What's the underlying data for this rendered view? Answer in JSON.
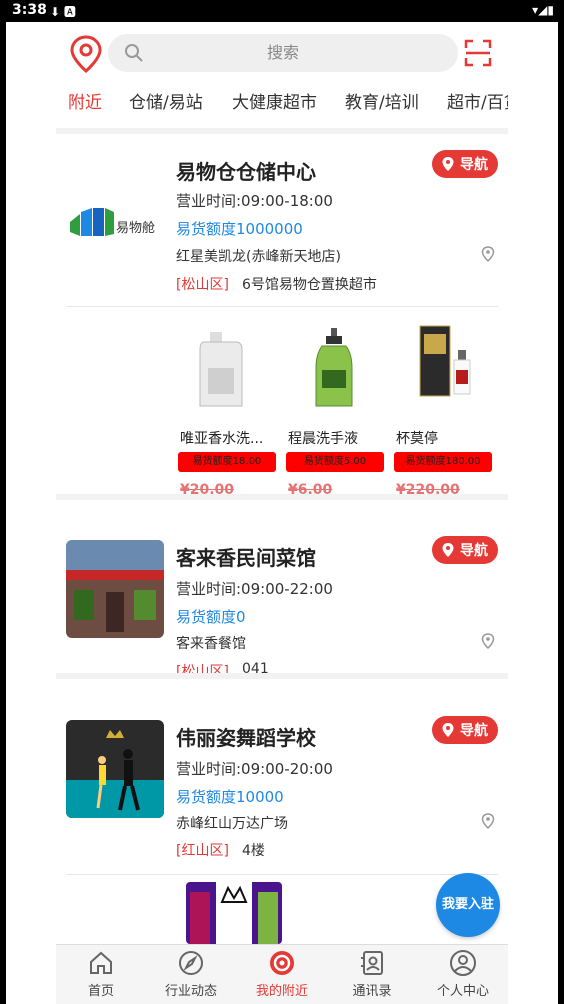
{
  "status_bar": {
    "time": "3:38",
    "left_icons": "⬇ 🅰",
    "right_icons": "▾◢▮"
  },
  "header": {
    "search_placeholder": "搜索"
  },
  "tabs": [
    "附近",
    "仓储/易站",
    "大健康超市",
    "教育/培训",
    "超市/百货"
  ],
  "colors": {
    "accent": "#e53935",
    "blue": "#1e88e5",
    "tag_red": "#ff0000"
  },
  "stores": [
    {
      "name": "易物仓仓储中心",
      "hours": "营业时间:09:00-18:00",
      "quota": "易货额度1000000",
      "address": "红星美凯龙(赤峰新天地店)",
      "district": "[松山区]",
      "address_detail": "6号馆易物仓置换超市",
      "nav_label": "导航",
      "logo_text": "易物舱",
      "products": [
        {
          "name": "唯亚香水洗...",
          "tag": "易货额度18.00",
          "price": "¥20.00"
        },
        {
          "name": "程晨洗手液",
          "tag": "易货额度5.00",
          "price": "¥6.00"
        },
        {
          "name": "杯莫停",
          "tag": "易货额度180.00",
          "price": "¥220.00"
        }
      ]
    },
    {
      "name": "客来香民间菜馆",
      "hours": "营业时间:09:00-22:00",
      "quota": "易货额度0",
      "address": "客来香餐馆",
      "district": "[松山区]",
      "address_detail": "041",
      "nav_label": "导航"
    },
    {
      "name": "伟丽姿舞蹈学校",
      "hours": "营业时间:09:00-20:00",
      "quota": "易货额度10000",
      "address": "赤峰红山万达广场",
      "district": "[红山区]",
      "address_detail": "4楼",
      "nav_label": "导航"
    }
  ],
  "join_button": "我要入驻",
  "bottom_nav": [
    {
      "label": "首页",
      "icon": "home-icon"
    },
    {
      "label": "行业动态",
      "icon": "compass-icon"
    },
    {
      "label": "我的附近",
      "icon": "nearby-icon"
    },
    {
      "label": "通讯录",
      "icon": "contacts-icon"
    },
    {
      "label": "个人中心",
      "icon": "profile-icon"
    }
  ]
}
